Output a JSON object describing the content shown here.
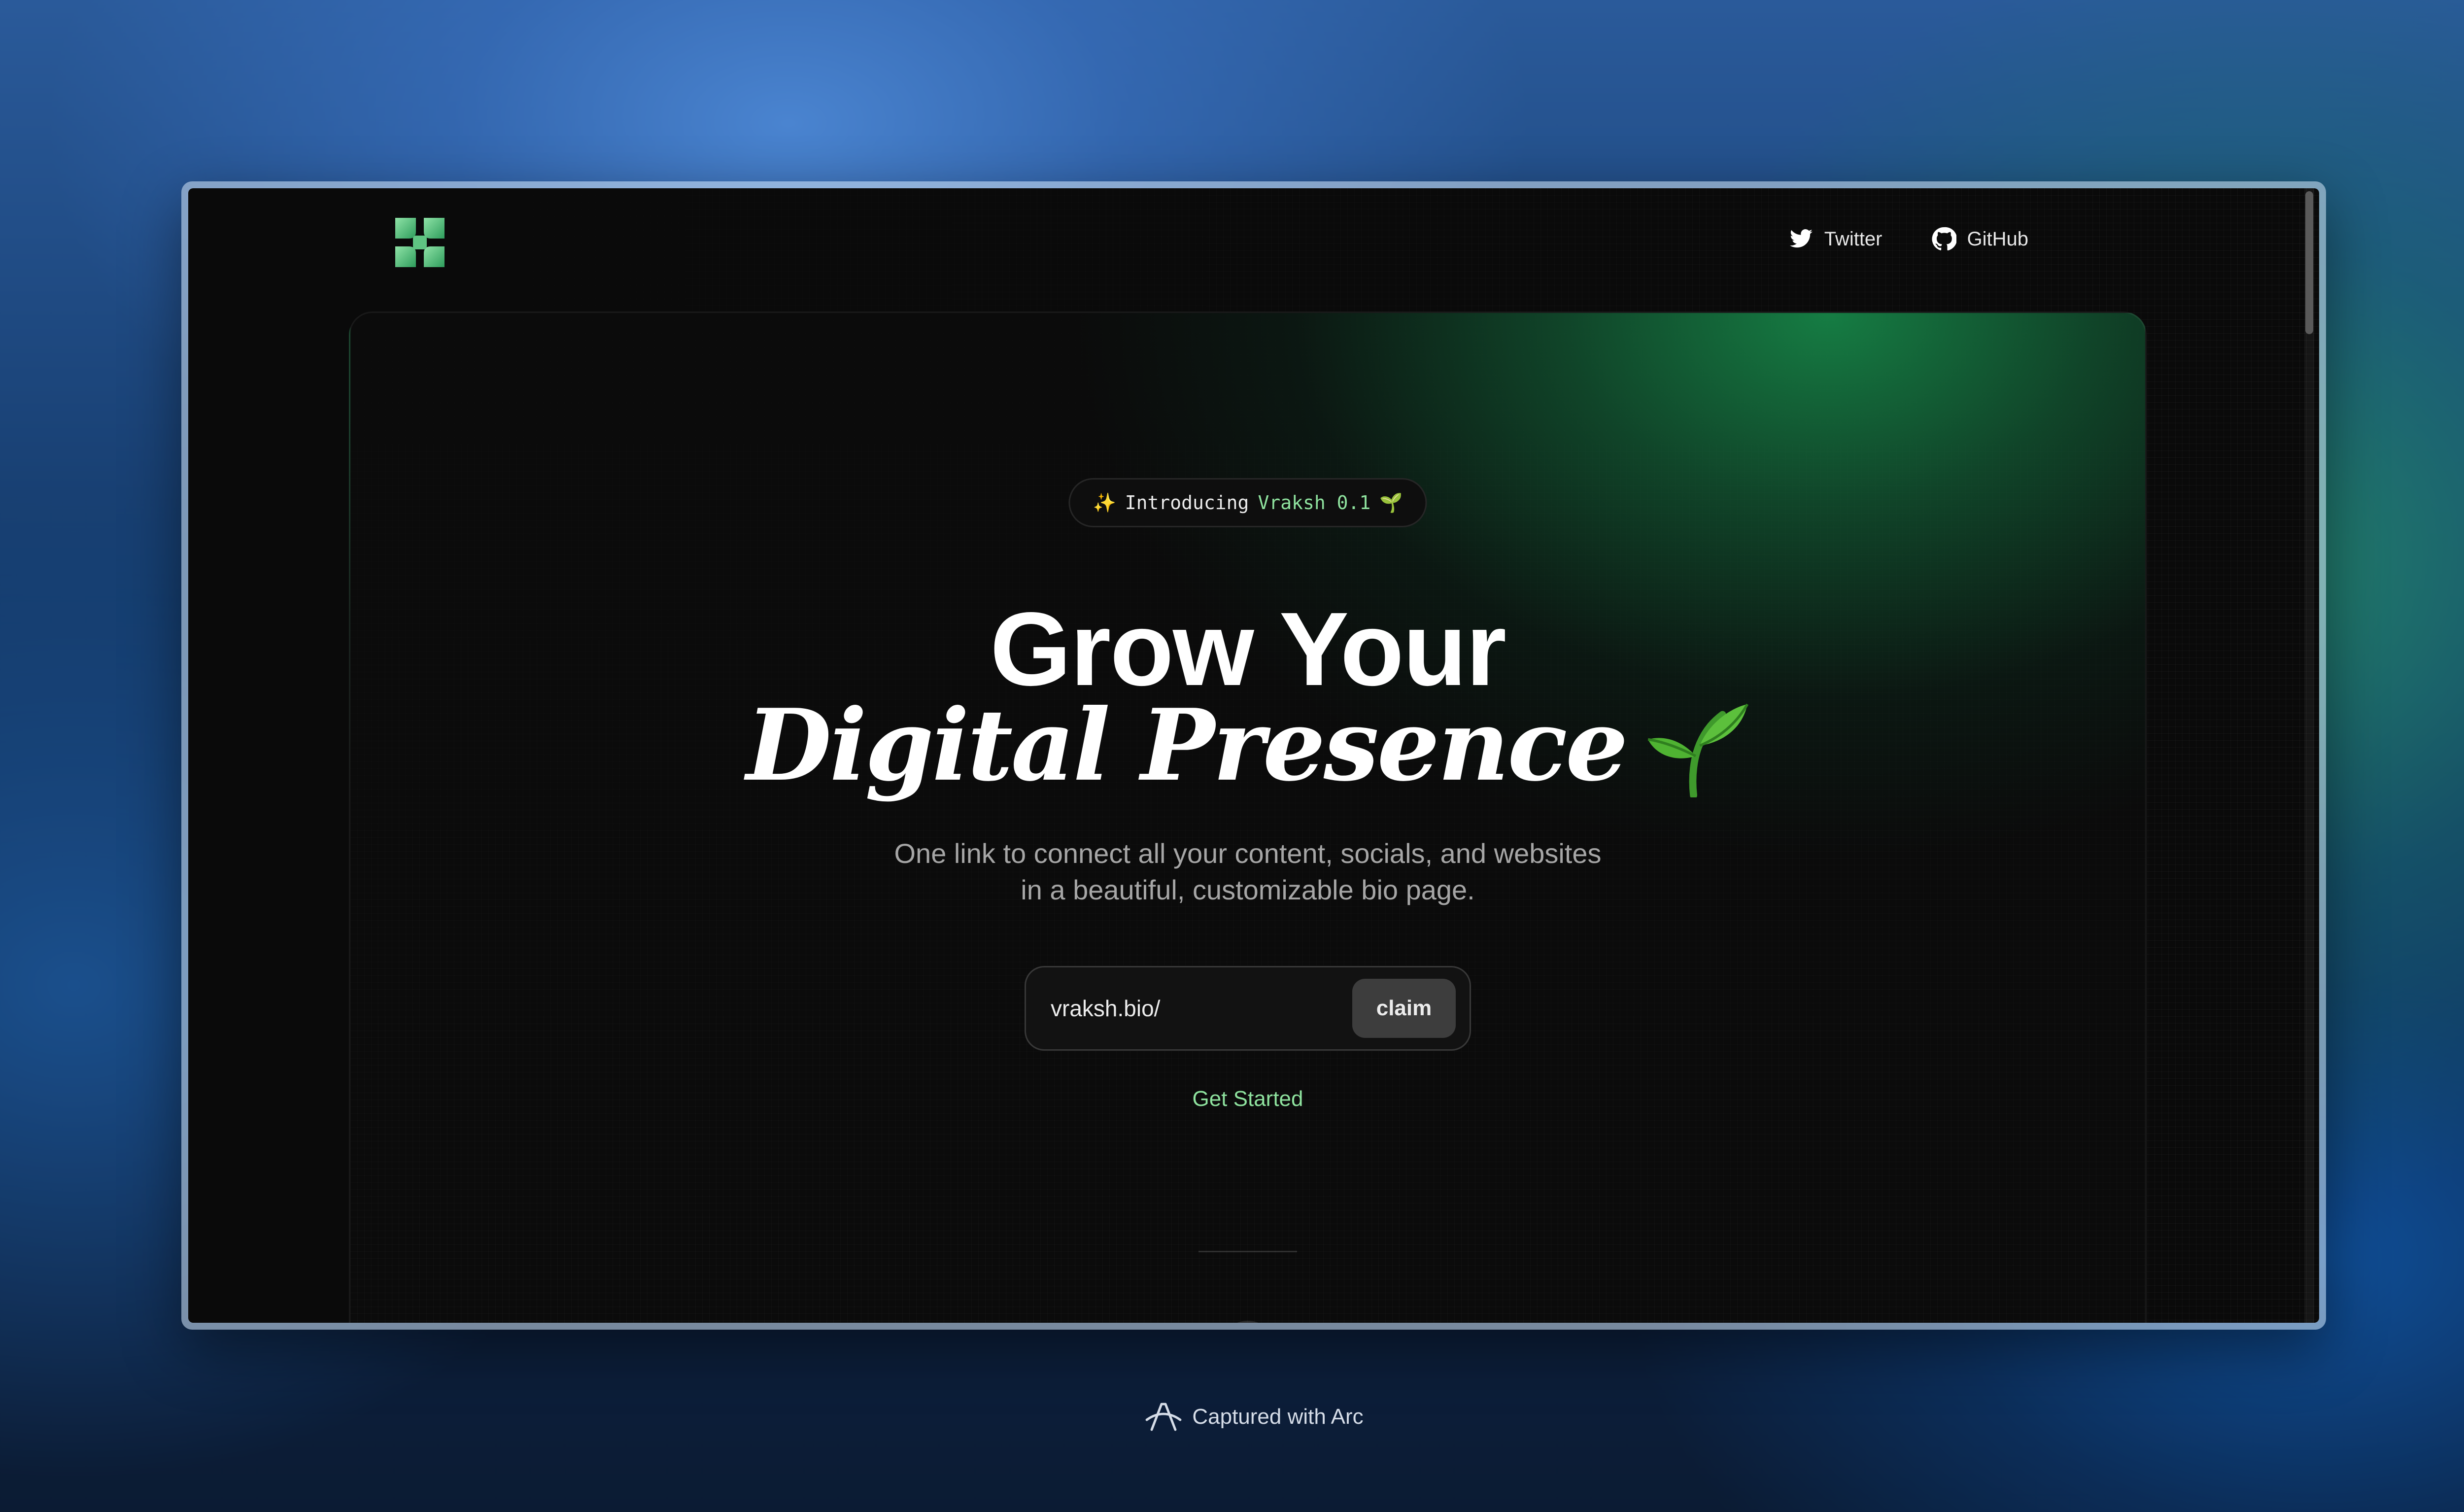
{
  "nav": {
    "links": [
      {
        "label": "Twitter",
        "icon": "twitter-icon"
      },
      {
        "label": "GitHub",
        "icon": "github-icon"
      }
    ]
  },
  "hero": {
    "badge": {
      "sparkle": "✨",
      "intro": "Introducing",
      "version": "Vraksh 0.1",
      "emoji": "🌱"
    },
    "title_line1": "Grow Your",
    "title_line2": "Digital Presence",
    "subtitle_line1": "One link to connect all your content, socials, and websites",
    "subtitle_line2": "in a beautiful, customizable bio page.",
    "claim": {
      "prefix": "vraksh.bio/",
      "button_label": "claim"
    },
    "cta_label": "Get Started"
  },
  "caption": {
    "label": "Captured with Arc"
  },
  "colors": {
    "accent_green": "#8fe39f",
    "glow_green": "#18964f",
    "background": "#0a0a0a"
  }
}
